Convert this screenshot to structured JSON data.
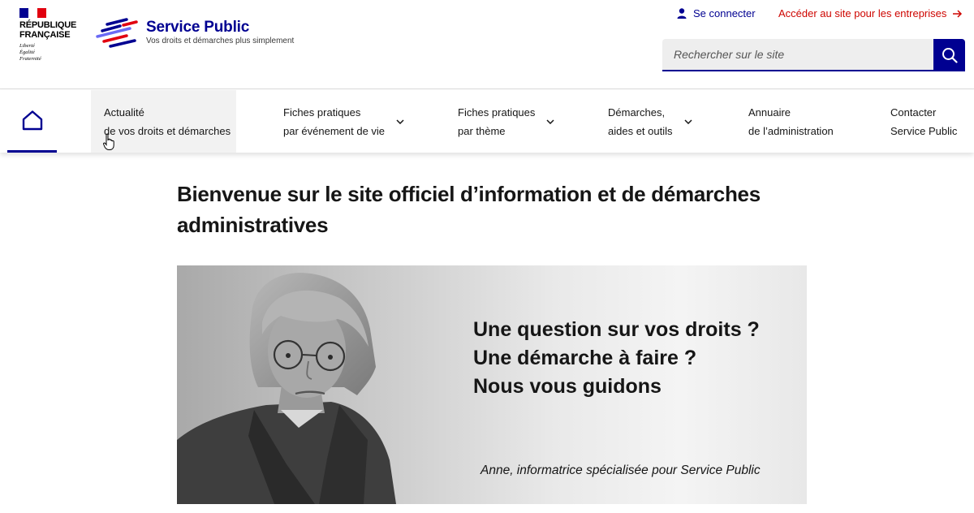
{
  "header": {
    "republique": [
      "RÉPUBLIQUE",
      "FRANÇAISE"
    ],
    "devise": [
      "Liberté",
      "Égalité",
      "Fraternité"
    ],
    "site_name": "Service Public",
    "tagline": "Vos droits et démarches plus simplement",
    "connect_label": "Se connecter",
    "entreprises_label": "Accéder au site pour les entreprises",
    "search_placeholder": "Rechercher sur le site"
  },
  "nav": {
    "items": [
      {
        "line1": "Actualité",
        "line2": "de vos droits et démarches",
        "dropdown": false
      },
      {
        "line1": "Fiches pratiques",
        "line2": "par événement de vie",
        "dropdown": true
      },
      {
        "line1": "Fiches pratiques",
        "line2": "par thème",
        "dropdown": true
      },
      {
        "line1": "Démarches,",
        "line2": "aides et outils",
        "dropdown": true
      },
      {
        "line1": "Annuaire",
        "line2": "de l’administration",
        "dropdown": false
      },
      {
        "line1": "Contacter",
        "line2": "Service Public",
        "dropdown": false
      }
    ]
  },
  "main": {
    "title": "Bienvenue sur le site officiel d’information et de démarches administratives",
    "banner": {
      "lines": [
        "Une question sur vos droits ?",
        "Une démarche à faire ?",
        "Nous vous guidons"
      ],
      "caption": "Anne, informatrice spécialisée pour Service Public"
    }
  },
  "colors": {
    "brand_blue": "#000091",
    "brand_red": "#e1000f",
    "link_red": "#ce0500",
    "hover_bg": "#f2f2f2"
  },
  "icons": {
    "home": "home-icon",
    "user": "user-icon",
    "arrow": "arrow-right-icon",
    "search": "search-icon",
    "chevron": "chevron-down-icon"
  }
}
